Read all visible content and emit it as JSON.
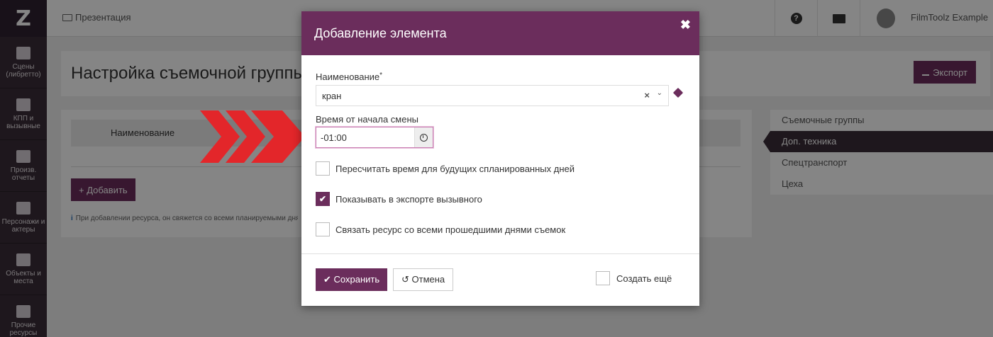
{
  "app": {
    "logo": "Z",
    "breadcrumb": "Презентация",
    "user_name": "FilmToolz Example",
    "help_icon": "?"
  },
  "sidebar": {
    "items": [
      {
        "label": "Сцены (либретто)",
        "icon": "clapper-icon"
      },
      {
        "label": "КПП и вызывные",
        "icon": "calendar-icon"
      },
      {
        "label": "Произв. отчеты",
        "icon": "checkbox-icon"
      },
      {
        "label": "Персонажи и актеры",
        "icon": "people-icon"
      },
      {
        "label": "Объекты и места",
        "icon": "image-icon"
      },
      {
        "label": "Прочие ресурсы",
        "icon": "box-icon"
      }
    ]
  },
  "page": {
    "title": "Настройка съемочной группы",
    "export_label": "Экспорт",
    "table_header_name": "Наименование",
    "add_label": "Добавить",
    "info_text": "При добавлении ресурса, он свяжется со всеми планируемыми днями"
  },
  "right_nav": {
    "items": [
      {
        "label": "Съемочные группы",
        "active": false
      },
      {
        "label": "Доп. техника",
        "active": true
      },
      {
        "label": "Спецтранспорт",
        "active": false
      },
      {
        "label": "Цеха",
        "active": false
      }
    ]
  },
  "modal": {
    "title": "Добавление элемента",
    "name_label": "Наименование",
    "required_mark": "*",
    "name_value": "кран",
    "time_label": "Время от начала смены",
    "time_value": "-01:00",
    "checkboxes": [
      {
        "label": "Пересчитать время для будущих спланированных дней",
        "checked": false
      },
      {
        "label": "Показывать в экспорте вызывного",
        "checked": true
      },
      {
        "label": "Связать ресурс со всеми прошедшими днями съемок",
        "checked": false
      }
    ],
    "save_label": "Сохранить",
    "cancel_label": "Отмена",
    "create_more_label": "Создать ещё"
  },
  "colors": {
    "brand": "#6b2d5c",
    "sidebar": "#3a2c38",
    "arrow": "#e3262a"
  }
}
